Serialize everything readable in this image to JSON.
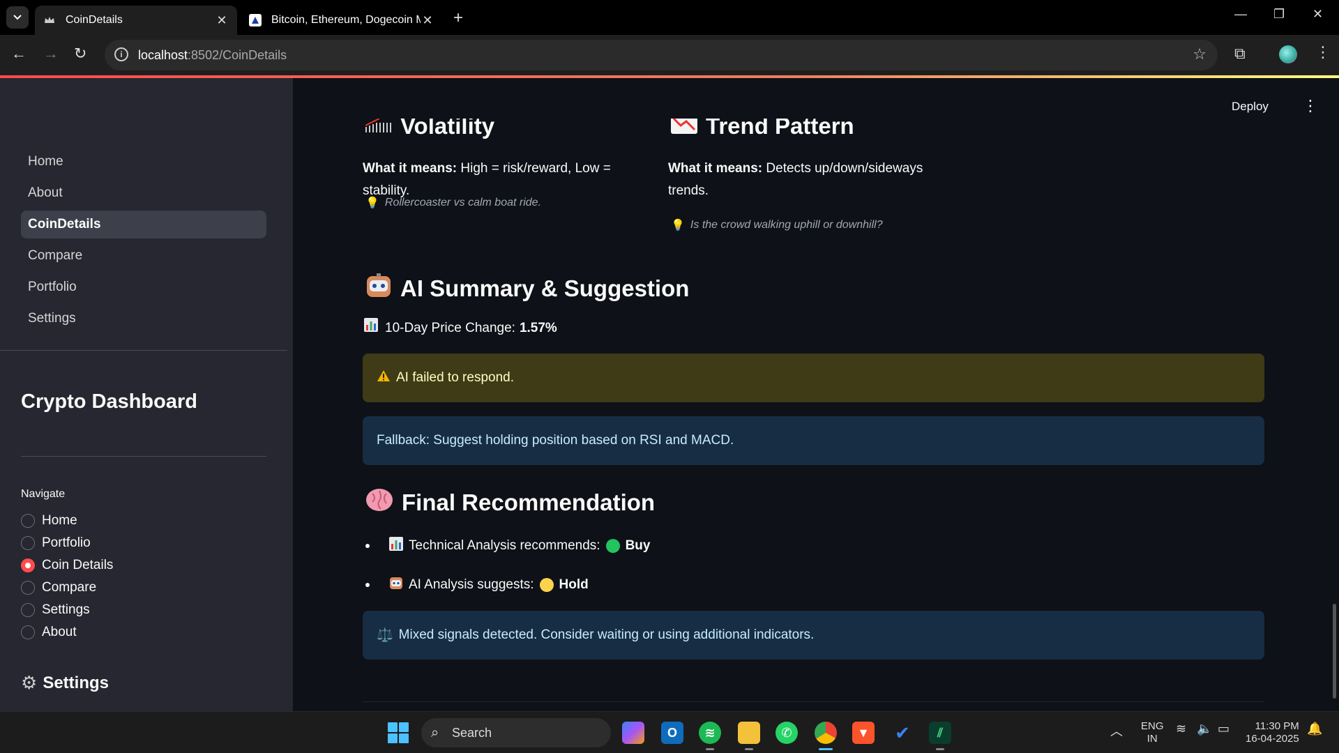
{
  "browser": {
    "tabs": [
      {
        "title": "CoinDetails",
        "active": true
      },
      {
        "title": "Bitcoin, Ethereum, Dogecoin M..",
        "active": false
      }
    ],
    "url_host": "localhost",
    "url_path": ":8502/CoinDetails"
  },
  "app": {
    "deploy_label": "Deploy"
  },
  "sidebar": {
    "pages": [
      {
        "label": "Home",
        "active": false
      },
      {
        "label": "About",
        "active": false
      },
      {
        "label": "CoinDetails",
        "active": true
      },
      {
        "label": "Compare",
        "active": false
      },
      {
        "label": "Portfolio",
        "active": false
      },
      {
        "label": "Settings",
        "active": false
      }
    ],
    "title": "Crypto Dashboard",
    "navigate_label": "Navigate",
    "radio_options": [
      {
        "label": "Home",
        "selected": false
      },
      {
        "label": "Portfolio",
        "selected": false
      },
      {
        "label": "Coin Details",
        "selected": true
      },
      {
        "label": "Compare",
        "selected": false
      },
      {
        "label": "Settings",
        "selected": false
      },
      {
        "label": "About",
        "selected": false
      }
    ],
    "settings_heading": "Settings"
  },
  "main": {
    "volatility": {
      "heading": "Volatility",
      "meaning_label": "What it means:",
      "meaning_text": " High = risk/reward, Low = stability.",
      "hint": "Rollercoaster vs calm boat ride."
    },
    "trend": {
      "heading": "Trend Pattern",
      "meaning_label": "What it means:",
      "meaning_text": " Detects up/down/sideways trends.",
      "hint": "Is the crowd walking uphill or downhill?"
    },
    "ai_summary": {
      "heading": "AI Summary & Suggestion",
      "price_change_label": "10-Day Price Change: ",
      "price_change_value": "1.57%",
      "warning": "AI failed to respond.",
      "fallback": "Fallback: Suggest holding position based on RSI and MACD."
    },
    "final": {
      "heading": "Final Recommendation",
      "technical_label": "Technical Analysis recommends:",
      "technical_value": "Buy",
      "technical_color": "#21c45d",
      "ai_label": "AI Analysis suggests:",
      "ai_value": "Hold",
      "ai_color": "#fcd34d",
      "mixed": "Mixed signals detected. Consider waiting or using additional indicators."
    }
  },
  "taskbar": {
    "search_label": "Search",
    "lang_line1": "ENG",
    "lang_line2": "IN",
    "time": "11:30 PM",
    "date": "16-04-2025"
  }
}
